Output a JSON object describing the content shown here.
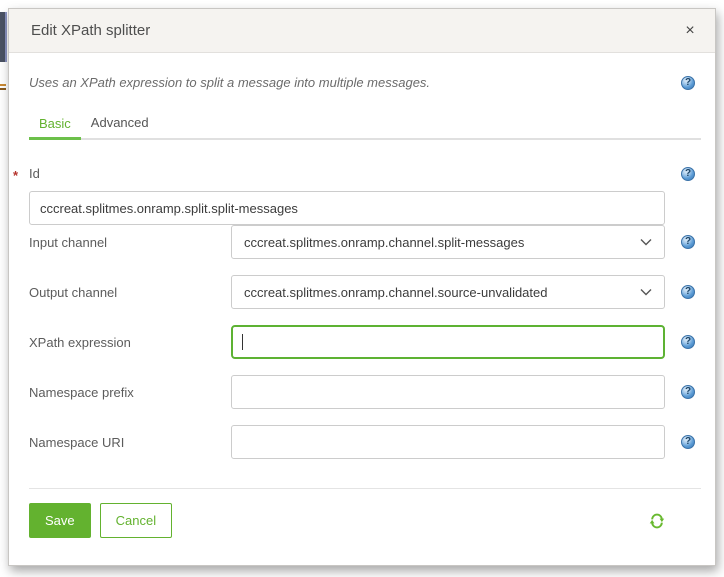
{
  "modal": {
    "title": "Edit XPath splitter",
    "close_icon": "×",
    "description": "Uses an XPath expression to split a message into multiple messages.",
    "tabs": [
      {
        "label": "Basic",
        "active": true
      },
      {
        "label": "Advanced",
        "active": false
      }
    ]
  },
  "fields": {
    "id": {
      "label": "Id",
      "required_marker": "*",
      "value": "cccreat.splitmes.onramp.split.split-messages"
    },
    "input_channel": {
      "label": "Input channel",
      "value": "cccreat.splitmes.onramp.channel.split-messages"
    },
    "output_channel": {
      "label": "Output channel",
      "value": "cccreat.splitmes.onramp.channel.source-unvalidated"
    },
    "xpath_expression": {
      "label": "XPath expression",
      "value": ""
    },
    "namespace_prefix": {
      "label": "Namespace prefix",
      "value": ""
    },
    "namespace_uri": {
      "label": "Namespace URI",
      "value": ""
    }
  },
  "footer": {
    "save_label": "Save",
    "cancel_label": "Cancel"
  },
  "icons": {
    "help_glyph": "?"
  },
  "colors": {
    "accent_green": "#63b22f",
    "tab_underline_green": "#6cc04a",
    "focus_border_green": "#5db233",
    "help_blue": "#5b9bd5",
    "required_red": "#b5342d",
    "header_bg": "#f5f3f0"
  }
}
